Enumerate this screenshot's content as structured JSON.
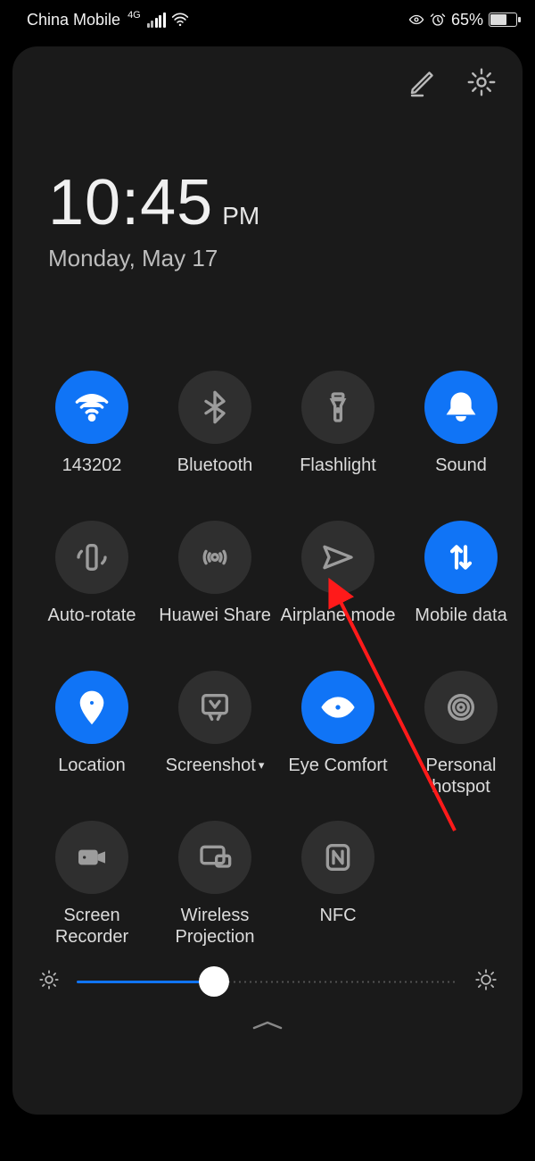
{
  "status": {
    "carrier": "China Mobile",
    "net_label": "4G",
    "battery_pct": "65%"
  },
  "clock": {
    "time": "10:45",
    "ampm": "PM",
    "date": "Monday, May 17"
  },
  "tiles": {
    "wifi": "143202",
    "bluetooth": "Bluetooth",
    "flashlight": "Flashlight",
    "sound": "Sound",
    "autorotate": "Auto-rotate",
    "huaweishare": "Huawei Share",
    "airplane": "Airplane mode",
    "mobiledata": "Mobile data",
    "location": "Location",
    "screenshot": "Screenshot",
    "eyecomfort": "Eye Comfort",
    "hotspot": "Personal hotspot",
    "recorder": "Screen Recorder",
    "projection": "Wireless Projection",
    "nfc": "NFC"
  },
  "brightness": {
    "percent": 36
  }
}
